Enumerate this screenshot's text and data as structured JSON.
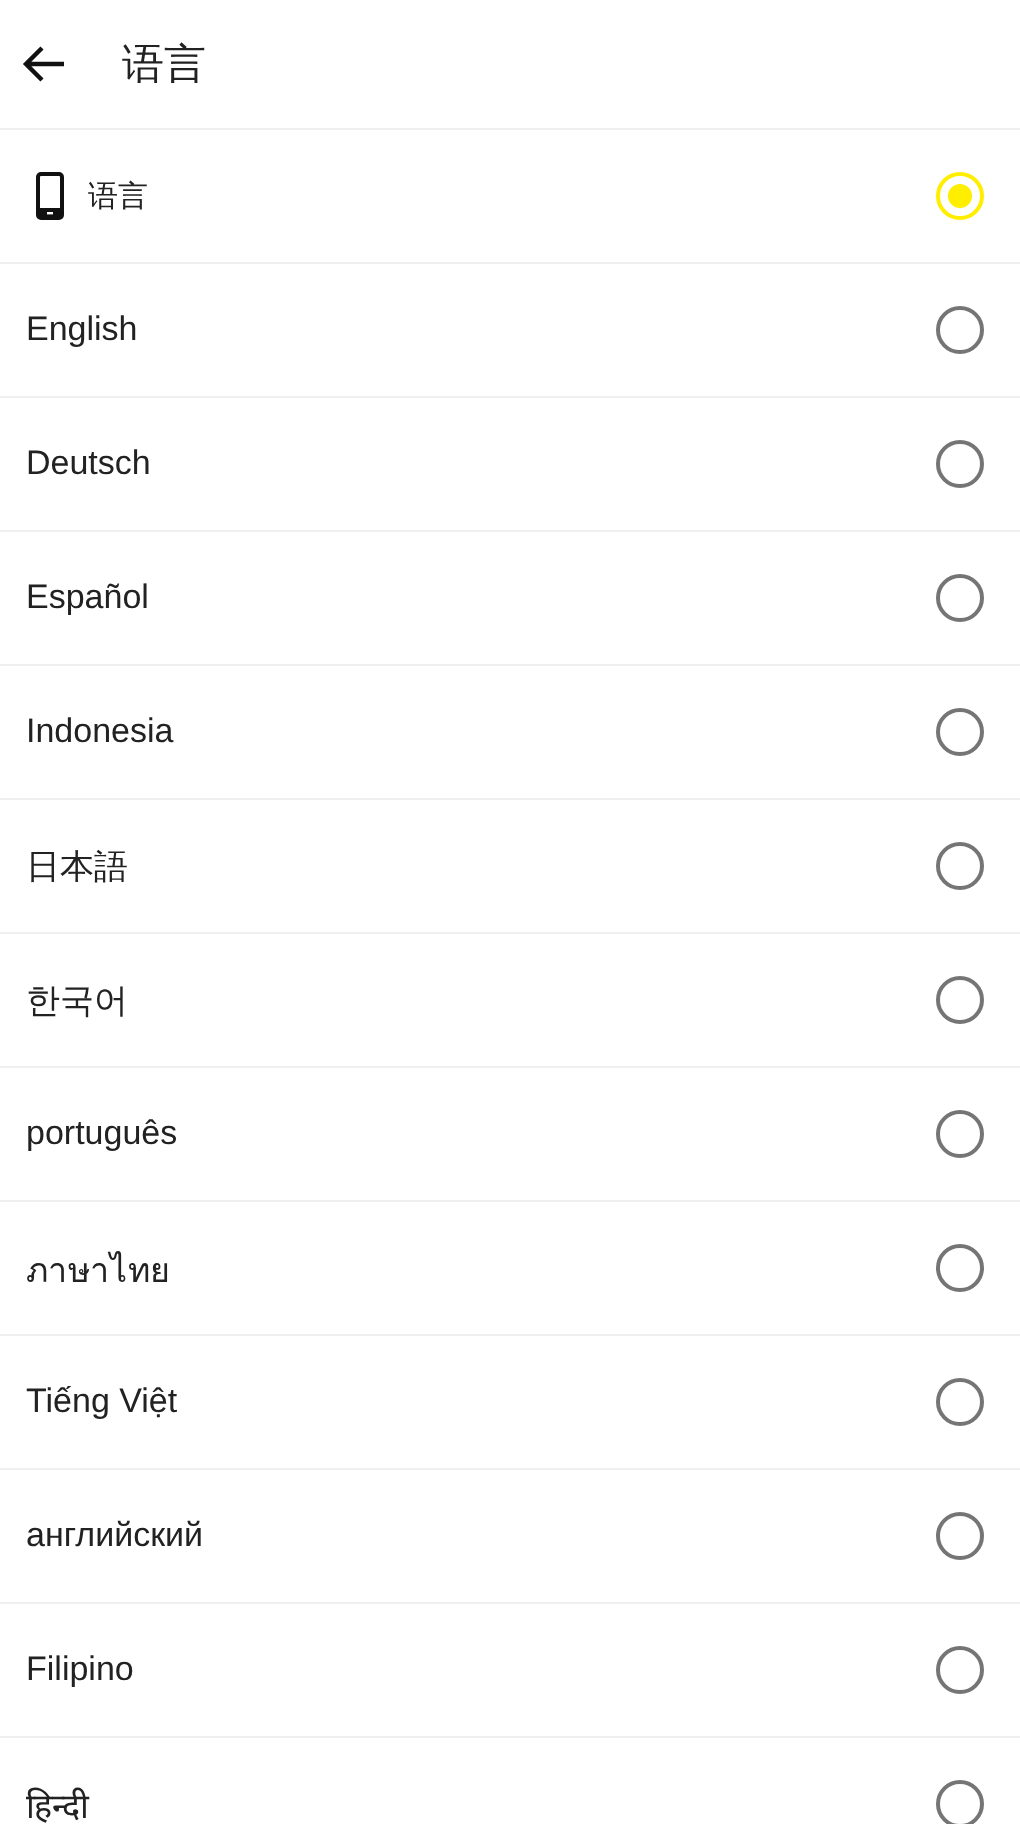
{
  "header": {
    "title": "语言"
  },
  "languages": [
    {
      "kind": "system",
      "label": "语言",
      "selected": true
    },
    {
      "kind": "plain",
      "label": "English",
      "selected": false
    },
    {
      "kind": "plain",
      "label": "Deutsch",
      "selected": false
    },
    {
      "kind": "plain",
      "label": "Español",
      "selected": false
    },
    {
      "kind": "plain",
      "label": "Indonesia",
      "selected": false
    },
    {
      "kind": "plain",
      "label": "日本語",
      "selected": false
    },
    {
      "kind": "plain",
      "label": "한국어",
      "selected": false
    },
    {
      "kind": "plain",
      "label": "português",
      "selected": false
    },
    {
      "kind": "plain",
      "label": "ภาษาไทย",
      "selected": false
    },
    {
      "kind": "plain",
      "label": "Tiếng Việt",
      "selected": false
    },
    {
      "kind": "plain",
      "label": "английский",
      "selected": false
    },
    {
      "kind": "plain",
      "label": "Filipino",
      "selected": false
    },
    {
      "kind": "plain",
      "label": "हिन्दी",
      "selected": false
    }
  ]
}
